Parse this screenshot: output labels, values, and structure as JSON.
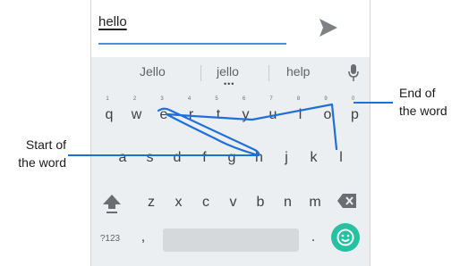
{
  "input": {
    "text": "hello"
  },
  "suggestions": [
    "Jello",
    "jello",
    "help"
  ],
  "keyboard": {
    "row1": [
      {
        "key": "q",
        "hint": "1"
      },
      {
        "key": "w",
        "hint": "2"
      },
      {
        "key": "e",
        "hint": "3"
      },
      {
        "key": "r",
        "hint": "4"
      },
      {
        "key": "t",
        "hint": "5"
      },
      {
        "key": "y",
        "hint": "6"
      },
      {
        "key": "u",
        "hint": "7"
      },
      {
        "key": "i",
        "hint": "8"
      },
      {
        "key": "o",
        "hint": "9"
      },
      {
        "key": "p",
        "hint": "0"
      }
    ],
    "row2": [
      "a",
      "s",
      "d",
      "f",
      "g",
      "h",
      "j",
      "k",
      "l"
    ],
    "row3": [
      "z",
      "x",
      "c",
      "v",
      "b",
      "n",
      "m"
    ],
    "symbols_label": "?123",
    "comma": ",",
    "period": "."
  },
  "annotations": {
    "start_label": [
      "Start of",
      "the word"
    ],
    "end_label": [
      "End of",
      "the word"
    ]
  },
  "colors": {
    "swipe_trail": "#1e6fd9",
    "accent": "#4b8fe0",
    "emoji_button": "#27c0a0"
  },
  "icons": {
    "send": "send-arrow-icon",
    "mic": "microphone-icon",
    "shift": "shift-arrow-icon",
    "backspace": "backspace-icon",
    "emoji": "smiley-face-icon"
  }
}
